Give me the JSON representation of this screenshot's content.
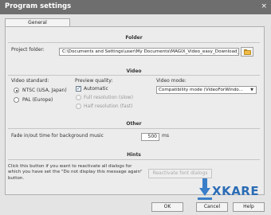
{
  "window": {
    "title": "Program settings",
    "close_symbol": "×"
  },
  "tabs": [
    {
      "label": "General"
    }
  ],
  "folder": {
    "heading": "Folder",
    "project_folder_label": "Project folder:",
    "project_folder_value": "C:\\Documents and Settings\\user\\My Documents\\MAGIX_Video_easy_Download_",
    "browse_icon": "folder-icon"
  },
  "video": {
    "heading": "Video",
    "standard_label": "Video standard:",
    "standards": [
      {
        "label": "NTSC (USA, Japan)",
        "selected": true
      },
      {
        "label": "PAL (Europe)",
        "selected": false
      }
    ],
    "quality_label": "Preview quality:",
    "qualities": [
      {
        "label": "Automatic",
        "checked": true,
        "enabled": true
      },
      {
        "label": "Full resolution (slow)",
        "enabled": false
      },
      {
        "label": "Half resolution (fast)",
        "enabled": false
      }
    ],
    "mode_label": "Video mode:",
    "mode_value": "Compatibility mode (VideoForWindo..."
  },
  "other": {
    "heading": "Other",
    "fade_label": "Fade in/out time for background music",
    "fade_value": "500",
    "fade_unit": "ms"
  },
  "hints": {
    "heading": "Hints",
    "description": "Click this button if you want to reactivate all dialogs for which you have set the \"Do not display this message again\" button.",
    "reactivate_button": "Reactivate font dialogs"
  },
  "footer": {
    "ok": "OK",
    "cancel": "Cancel",
    "help": "Help"
  },
  "watermark": {
    "text": "XKARE",
    "color": "#2b6cb5"
  }
}
